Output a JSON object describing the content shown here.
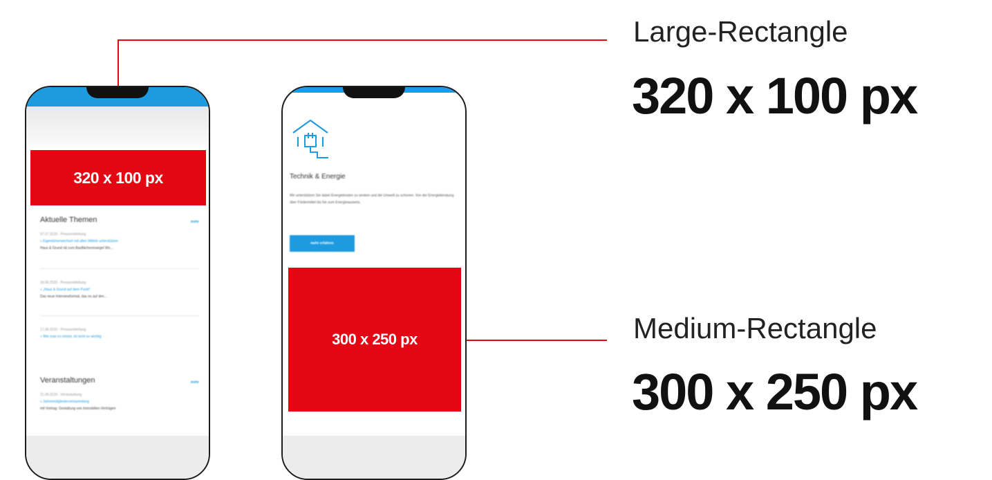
{
  "labels": {
    "large_name": "Large-Rectangle",
    "large_size": "320 x 100 px",
    "medium_name": "Medium-Rectangle",
    "medium_size": "300 x 250 px"
  },
  "phone1": {
    "ad_label": "320 x 100 px",
    "section1_title": "Aktuelle Themen",
    "section1_more": "mehr",
    "news": [
      {
        "meta": "07.07.2020 - Pressemitteilung",
        "link": "» Eigentümerwechsel mit allen Mitteln unterstützen",
        "text": "Haus & Grund rät zum Bauflächenmangel Wo..."
      },
      {
        "meta": "18.06.2020 - Pressemitteilung",
        "link": "» „Haus & Grund auf dem Punkt“",
        "text": "Das neue Interviewformat, das es auf den..."
      },
      {
        "meta": "17.06.2020 - Pressemitteilung",
        "link": "» Wie man es nimmt, ist nicht so wichtig",
        "text": ""
      }
    ],
    "section2_title": "Veranstaltungen",
    "section2_more": "mehr",
    "events": [
      {
        "meta": "21.09.2020 - Veranstaltung",
        "link": "» Jahresmitgliederversammlung",
        "text": "mit Vortrag: Gestaltung von Immobilien-Verträgen"
      }
    ]
  },
  "phone2": {
    "icon": "house-plug-icon",
    "heading": "Technik & Energie",
    "body": "Wir unterstützen Sie dabei Energiekosten zu senken und die Umwelt zu schonen. Von der Energieberatung über Fördermittel bis hin zum Energieausweis.",
    "button": "mehr erfahren",
    "ad_label": "300 x 250 px"
  },
  "colors": {
    "accent_red": "#e30613",
    "accent_blue": "#1e9be0"
  }
}
